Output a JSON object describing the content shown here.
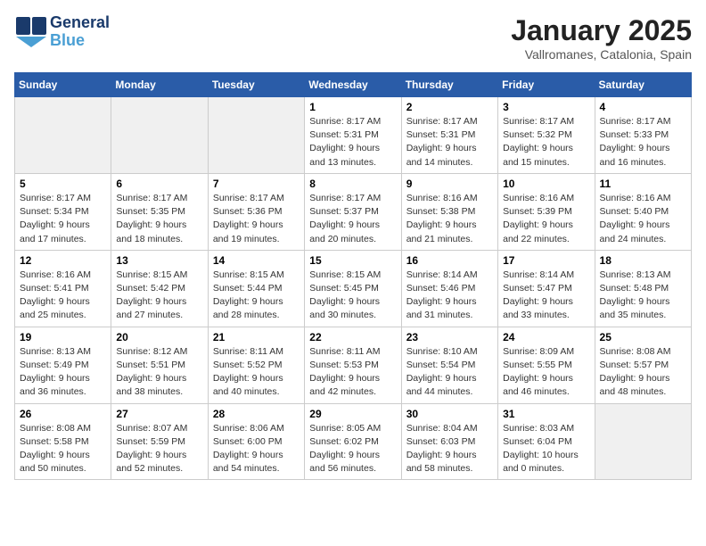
{
  "header": {
    "logo_line1": "General",
    "logo_line2": "Blue",
    "month": "January 2025",
    "location": "Vallromanes, Catalonia, Spain"
  },
  "days_of_week": [
    "Sunday",
    "Monday",
    "Tuesday",
    "Wednesday",
    "Thursday",
    "Friday",
    "Saturday"
  ],
  "weeks": [
    [
      {
        "day": "",
        "detail": ""
      },
      {
        "day": "",
        "detail": ""
      },
      {
        "day": "",
        "detail": ""
      },
      {
        "day": "1",
        "detail": "Sunrise: 8:17 AM\nSunset: 5:31 PM\nDaylight: 9 hours\nand 13 minutes."
      },
      {
        "day": "2",
        "detail": "Sunrise: 8:17 AM\nSunset: 5:31 PM\nDaylight: 9 hours\nand 14 minutes."
      },
      {
        "day": "3",
        "detail": "Sunrise: 8:17 AM\nSunset: 5:32 PM\nDaylight: 9 hours\nand 15 minutes."
      },
      {
        "day": "4",
        "detail": "Sunrise: 8:17 AM\nSunset: 5:33 PM\nDaylight: 9 hours\nand 16 minutes."
      }
    ],
    [
      {
        "day": "5",
        "detail": "Sunrise: 8:17 AM\nSunset: 5:34 PM\nDaylight: 9 hours\nand 17 minutes."
      },
      {
        "day": "6",
        "detail": "Sunrise: 8:17 AM\nSunset: 5:35 PM\nDaylight: 9 hours\nand 18 minutes."
      },
      {
        "day": "7",
        "detail": "Sunrise: 8:17 AM\nSunset: 5:36 PM\nDaylight: 9 hours\nand 19 minutes."
      },
      {
        "day": "8",
        "detail": "Sunrise: 8:17 AM\nSunset: 5:37 PM\nDaylight: 9 hours\nand 20 minutes."
      },
      {
        "day": "9",
        "detail": "Sunrise: 8:16 AM\nSunset: 5:38 PM\nDaylight: 9 hours\nand 21 minutes."
      },
      {
        "day": "10",
        "detail": "Sunrise: 8:16 AM\nSunset: 5:39 PM\nDaylight: 9 hours\nand 22 minutes."
      },
      {
        "day": "11",
        "detail": "Sunrise: 8:16 AM\nSunset: 5:40 PM\nDaylight: 9 hours\nand 24 minutes."
      }
    ],
    [
      {
        "day": "12",
        "detail": "Sunrise: 8:16 AM\nSunset: 5:41 PM\nDaylight: 9 hours\nand 25 minutes."
      },
      {
        "day": "13",
        "detail": "Sunrise: 8:15 AM\nSunset: 5:42 PM\nDaylight: 9 hours\nand 27 minutes."
      },
      {
        "day": "14",
        "detail": "Sunrise: 8:15 AM\nSunset: 5:44 PM\nDaylight: 9 hours\nand 28 minutes."
      },
      {
        "day": "15",
        "detail": "Sunrise: 8:15 AM\nSunset: 5:45 PM\nDaylight: 9 hours\nand 30 minutes."
      },
      {
        "day": "16",
        "detail": "Sunrise: 8:14 AM\nSunset: 5:46 PM\nDaylight: 9 hours\nand 31 minutes."
      },
      {
        "day": "17",
        "detail": "Sunrise: 8:14 AM\nSunset: 5:47 PM\nDaylight: 9 hours\nand 33 minutes."
      },
      {
        "day": "18",
        "detail": "Sunrise: 8:13 AM\nSunset: 5:48 PM\nDaylight: 9 hours\nand 35 minutes."
      }
    ],
    [
      {
        "day": "19",
        "detail": "Sunrise: 8:13 AM\nSunset: 5:49 PM\nDaylight: 9 hours\nand 36 minutes."
      },
      {
        "day": "20",
        "detail": "Sunrise: 8:12 AM\nSunset: 5:51 PM\nDaylight: 9 hours\nand 38 minutes."
      },
      {
        "day": "21",
        "detail": "Sunrise: 8:11 AM\nSunset: 5:52 PM\nDaylight: 9 hours\nand 40 minutes."
      },
      {
        "day": "22",
        "detail": "Sunrise: 8:11 AM\nSunset: 5:53 PM\nDaylight: 9 hours\nand 42 minutes."
      },
      {
        "day": "23",
        "detail": "Sunrise: 8:10 AM\nSunset: 5:54 PM\nDaylight: 9 hours\nand 44 minutes."
      },
      {
        "day": "24",
        "detail": "Sunrise: 8:09 AM\nSunset: 5:55 PM\nDaylight: 9 hours\nand 46 minutes."
      },
      {
        "day": "25",
        "detail": "Sunrise: 8:08 AM\nSunset: 5:57 PM\nDaylight: 9 hours\nand 48 minutes."
      }
    ],
    [
      {
        "day": "26",
        "detail": "Sunrise: 8:08 AM\nSunset: 5:58 PM\nDaylight: 9 hours\nand 50 minutes."
      },
      {
        "day": "27",
        "detail": "Sunrise: 8:07 AM\nSunset: 5:59 PM\nDaylight: 9 hours\nand 52 minutes."
      },
      {
        "day": "28",
        "detail": "Sunrise: 8:06 AM\nSunset: 6:00 PM\nDaylight: 9 hours\nand 54 minutes."
      },
      {
        "day": "29",
        "detail": "Sunrise: 8:05 AM\nSunset: 6:02 PM\nDaylight: 9 hours\nand 56 minutes."
      },
      {
        "day": "30",
        "detail": "Sunrise: 8:04 AM\nSunset: 6:03 PM\nDaylight: 9 hours\nand 58 minutes."
      },
      {
        "day": "31",
        "detail": "Sunrise: 8:03 AM\nSunset: 6:04 PM\nDaylight: 10 hours\nand 0 minutes."
      },
      {
        "day": "",
        "detail": ""
      }
    ]
  ]
}
